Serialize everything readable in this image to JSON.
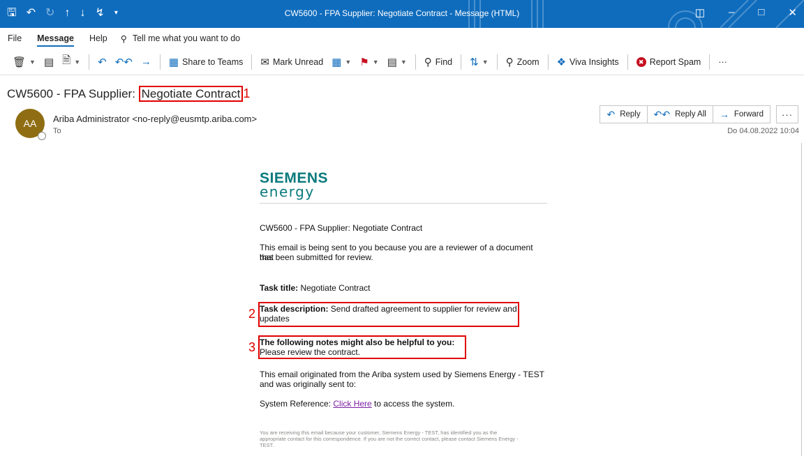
{
  "window": {
    "title": "CW5600 - FPA Supplier: Negotiate Contract  -  Message (HTML)",
    "quick_access_icons": [
      "save-icon",
      "undo-icon",
      "redo-icon",
      "up-arrow-icon",
      "down-arrow-icon",
      "touch-mode-icon",
      "customize-icon"
    ],
    "controls": [
      "ribbon-display-icon",
      "minimize-icon",
      "restore-icon",
      "close-icon"
    ]
  },
  "menu": {
    "file": "File",
    "message": "Message",
    "help": "Help",
    "tell_me": "Tell me what you want to do"
  },
  "ribbon": {
    "share_to_teams": "Share to Teams",
    "mark_unread": "Mark Unread",
    "find": "Find",
    "zoom": "Zoom",
    "viva_insights": "Viva Insights",
    "report_spam": "Report Spam",
    "more": "···"
  },
  "header": {
    "subject_prefix": "CW5600 - FPA Supplier: ",
    "subject_highlight": "Negotiate Contract",
    "annotation_1": "1",
    "avatar_initials": "AA",
    "sender": "Ariba Administrator <no-reply@eusmtp.ariba.com>",
    "to_label": "To",
    "reply": "Reply",
    "reply_all": "Reply All",
    "forward": "Forward",
    "more": "···",
    "date": "Do 04.08.2022 10:04"
  },
  "body": {
    "logo_line1": "SIEMENS",
    "logo_line2": "energy",
    "subject_line": "CW5600 - FPA Supplier: Negotiate Contract",
    "intro_line1": "This email is being sent to you because you are a reviewer of a document that",
    "intro_line2": "has been submitted for review.",
    "task_title_label": "Task title:",
    "task_title_value": " Negotiate Contract",
    "task_desc_label": "Task description:",
    "task_desc_value_line1": " Send drafted agreement to supplier for review and",
    "task_desc_value_line2": "updates",
    "annotation_2": "2",
    "notes_label": "The following notes might also be helpful to you:",
    "notes_value": "Please review the contract.",
    "annotation_3": "3",
    "origin_line1": "This email originated from the Ariba system used by Siemens Energy - TEST",
    "origin_line2": "and was originally sent to:",
    "sysref_label": "System Reference: ",
    "sysref_link": "Click Here",
    "sysref_suffix": " to access the system.",
    "footer_line1": "You are receiving this email because your customer, Siemens Energy - TEST, has identified you as the",
    "footer_line2": "appropriate contact for this correspondence. If you are not the correct contact, please contact Siemens Energy -",
    "footer_line3": "TEST."
  }
}
